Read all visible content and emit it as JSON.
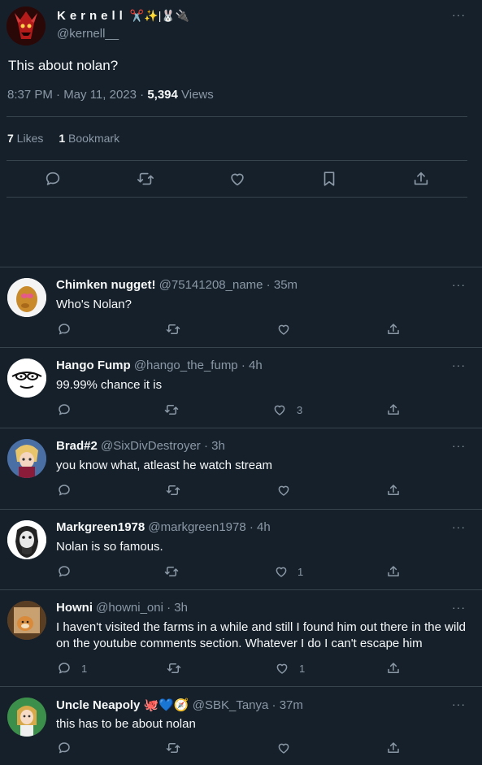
{
  "tweet": {
    "display_name": "Kernell",
    "name_emoji": "✂️✨|🐰🔌",
    "handle": "@kernell__",
    "text": "This about nolan?",
    "time": "8:37 PM · May 11, 2023 · ",
    "views_count": "5,394",
    "views_label": " Views",
    "likes_count": "7",
    "likes_label": " Likes",
    "bookmarks_count": "1",
    "bookmarks_label": " Bookmark",
    "more": "···"
  },
  "replies": [
    {
      "name": "Chimken nugget!",
      "handle": "@75141208_name",
      "time": " · 35m",
      "text": "Who's Nolan?",
      "reply_count": "",
      "like_count": "",
      "more": "···"
    },
    {
      "name": "Hango Fump",
      "handle": "@hango_the_fump",
      "time": " · 4h",
      "text": "99.99% chance it is",
      "reply_count": "",
      "like_count": "3",
      "more": "···"
    },
    {
      "name": "Brad#2",
      "handle": "@SixDivDestroyer",
      "time": " · 3h",
      "text": "you know what, atleast he watch stream",
      "reply_count": "",
      "like_count": "",
      "more": "···"
    },
    {
      "name": "Markgreen1978",
      "handle": "@markgreen1978",
      "time": " · 4h",
      "text": "Nolan is so famous.",
      "reply_count": "",
      "like_count": "1",
      "more": "···"
    },
    {
      "name": "Howni",
      "handle": "@howni_oni",
      "time": " · 3h",
      "text": "I haven't visited the farms in a while and still I found him out there in the wild on the youtube comments section. Whatever I do I can't escape him",
      "reply_count": "1",
      "like_count": "1",
      "more": "···"
    },
    {
      "name": "Uncle Neapoly",
      "name_emoji": "🐙💙🧭",
      "handle": "@SBK_Tanya",
      "time": " · 37m",
      "text": "this has to be about nolan",
      "reply_count": "",
      "like_count": "",
      "more": "···"
    }
  ],
  "colors": {
    "background": "#15202b",
    "divider": "#38444d",
    "muted": "#8b98a5",
    "text": "#f7f9f9"
  }
}
